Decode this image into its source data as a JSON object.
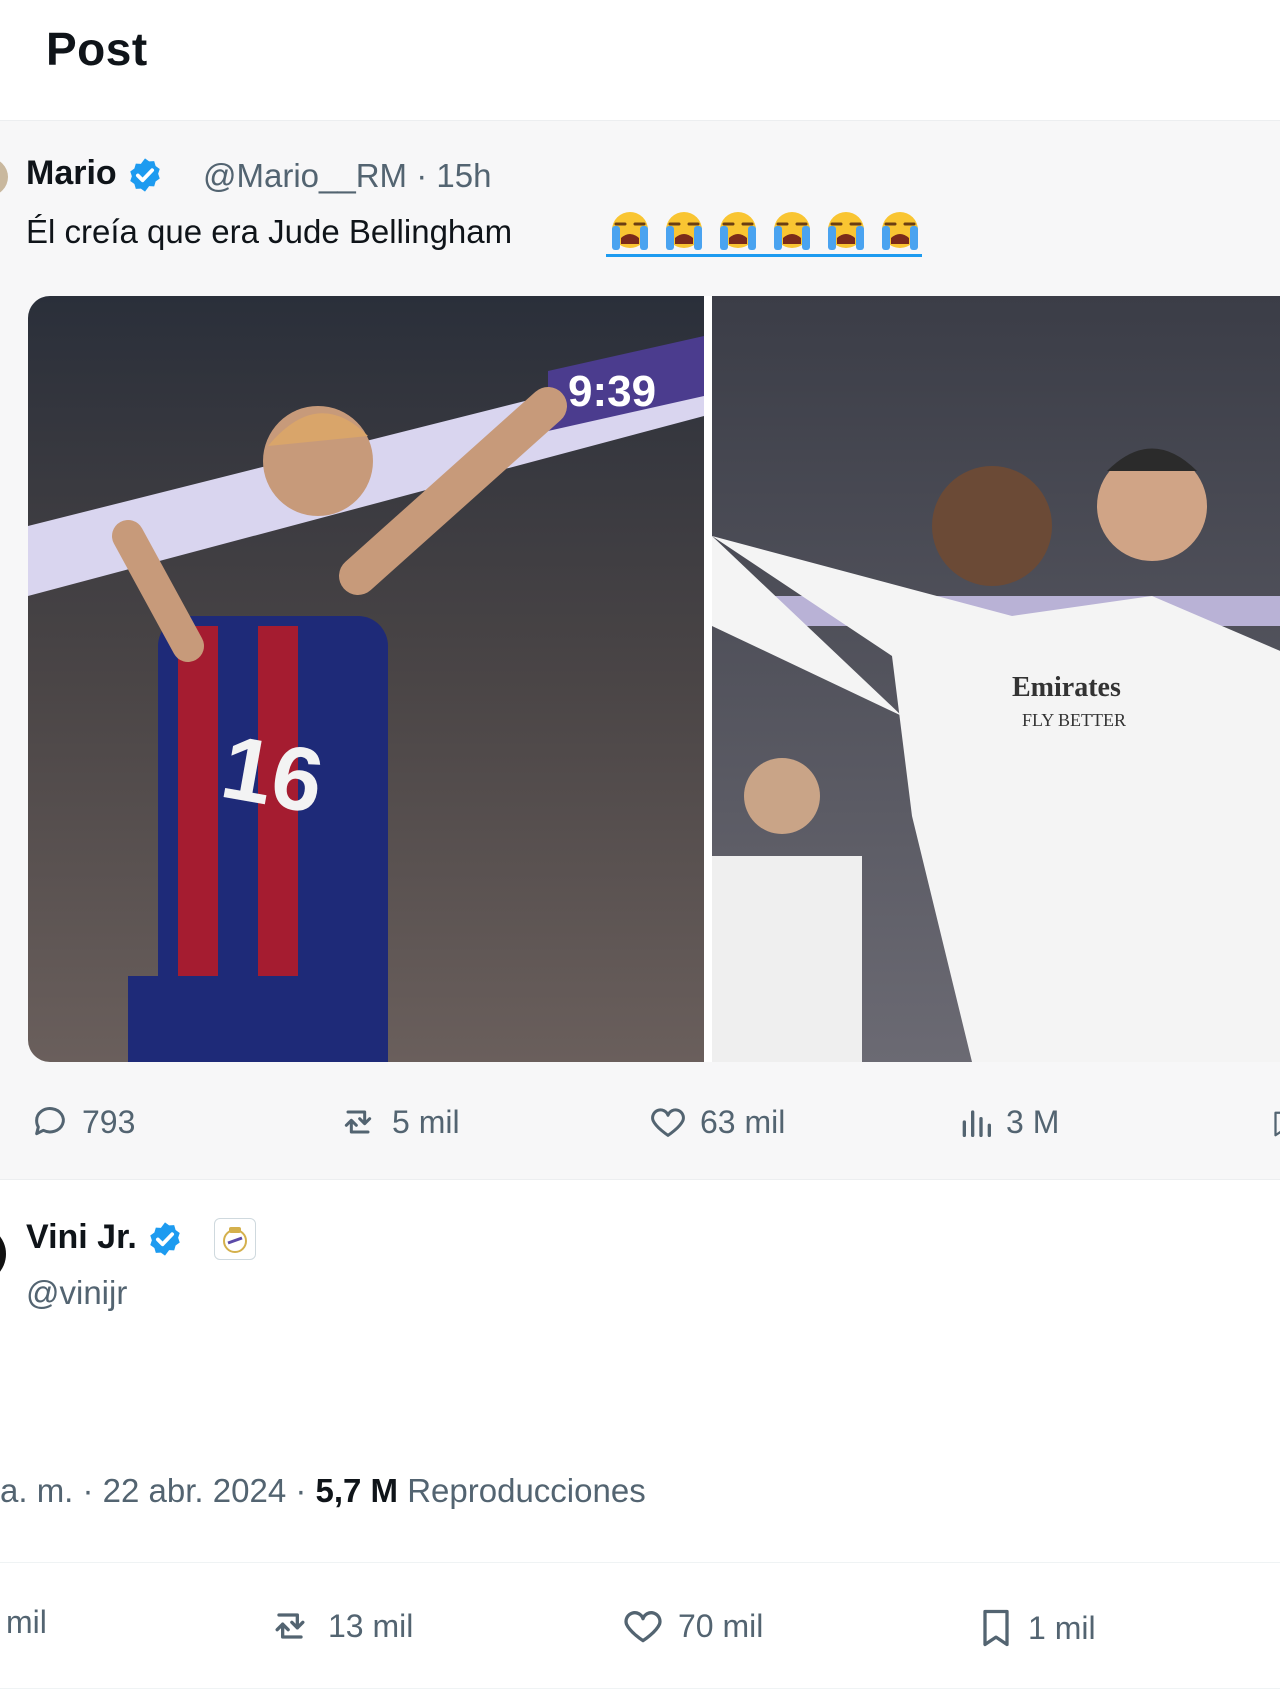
{
  "header": {
    "title": "Post"
  },
  "quoted_post": {
    "name": "Mario",
    "handle_time": "@Mario__RM · 15h",
    "text": "Él creía que era Jude Bellingham",
    "emoji_count": 6,
    "images": [
      {
        "description_icon": "photo-left",
        "overlay": "1 9:39"
      },
      {
        "description_icon": "photo-right"
      }
    ],
    "actions": {
      "replies": "793",
      "reposts": "5 mil",
      "likes": "63 mil",
      "views": "3 M"
    }
  },
  "main_post": {
    "name": "Vini Jr.",
    "handle": "@vinijr",
    "meta_prefix": "a. m. · 22 abr. 2024 · ",
    "views_count": "5,7 M",
    "views_label": " Reproducciones",
    "actions": {
      "replies": "mil",
      "reposts": "13 mil",
      "likes": "70 mil",
      "bookmarks": "1 mil"
    }
  },
  "colors": {
    "accent": "#1d9bf0",
    "muted": "#536471",
    "text": "#0f1419"
  }
}
